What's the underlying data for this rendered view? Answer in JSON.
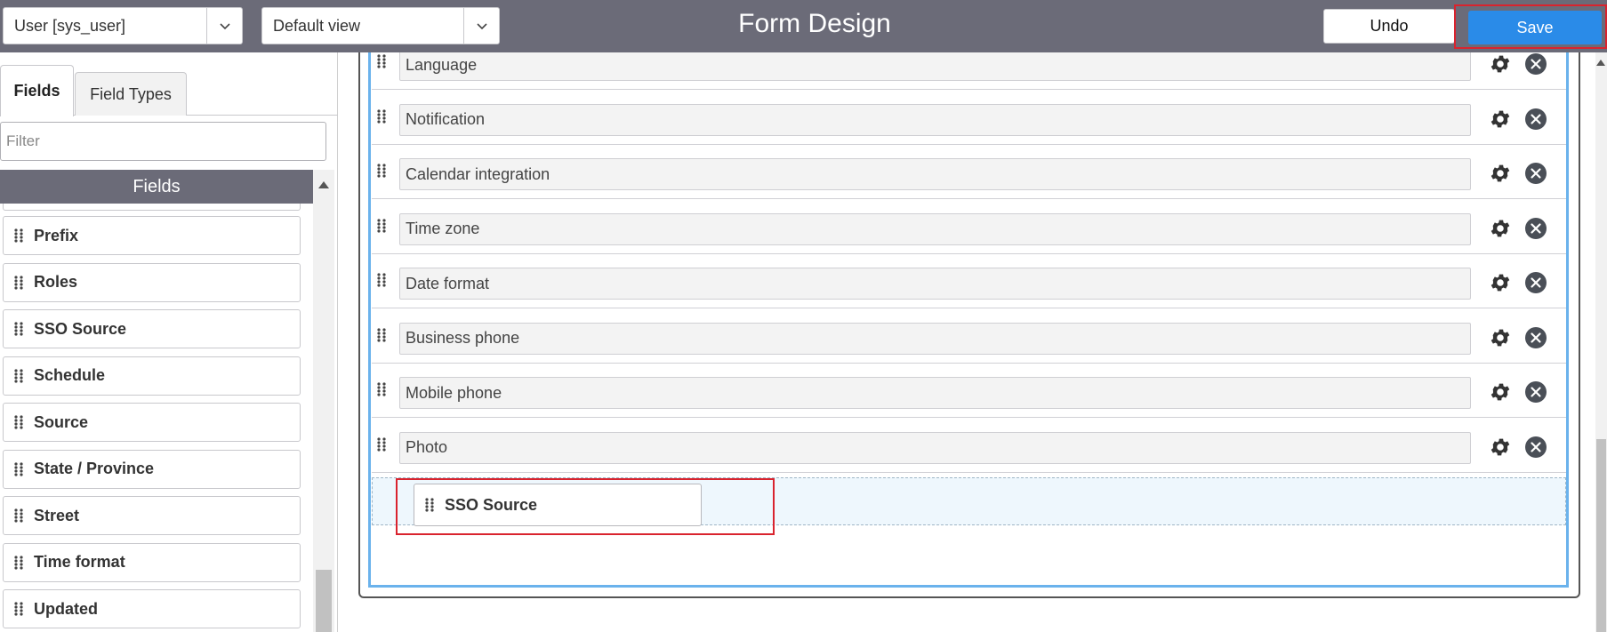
{
  "header": {
    "table_select": "User [sys_user]",
    "view_select": "Default view",
    "title": "Form Design",
    "undo_label": "Undo",
    "save_label": "Save"
  },
  "left_panel": {
    "tabs": [
      {
        "label": "Fields",
        "active": true
      },
      {
        "label": "Field Types",
        "active": false
      }
    ],
    "filter_placeholder": "Filter",
    "section_title": "Fields",
    "items": [
      {
        "label": "Prefix"
      },
      {
        "label": "Roles"
      },
      {
        "label": "SSO Source"
      },
      {
        "label": "Schedule"
      },
      {
        "label": "Source"
      },
      {
        "label": "State / Province"
      },
      {
        "label": "Street"
      },
      {
        "label": "Time format"
      },
      {
        "label": "Updated"
      }
    ]
  },
  "form": {
    "rows": [
      {
        "label": "Language"
      },
      {
        "label": "Notification"
      },
      {
        "label": "Calendar integration"
      },
      {
        "label": "Time zone"
      },
      {
        "label": "Date format"
      },
      {
        "label": "Business phone"
      },
      {
        "label": "Mobile phone"
      },
      {
        "label": "Photo"
      }
    ],
    "dragged_item": "SSO Source"
  },
  "colors": {
    "header_bg": "#6b6b78",
    "save_blue": "#2a8be8",
    "highlight_red": "#d9232e",
    "section_border_blue": "#6ab2ec"
  },
  "icons": {
    "grip": "drag-handle-icon",
    "gear": "gear-icon",
    "close": "close-circle-icon",
    "chevron": "chevron-down-icon"
  }
}
